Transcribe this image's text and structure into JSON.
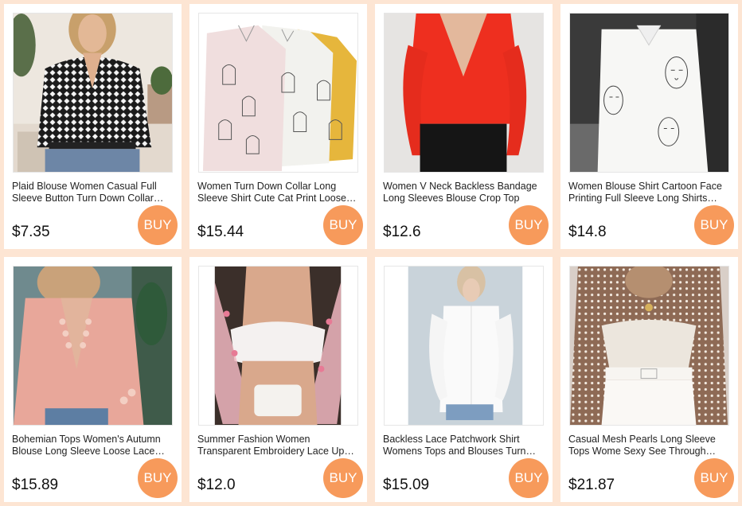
{
  "buy_label": "BUY",
  "accent_color": "#f79a5b",
  "background_color": "#fde5d3",
  "products": [
    {
      "title": "Plaid Blouse Women Casual Full Sleeve Button Turn Down Collar Shirt",
      "price": "$7.35",
      "image": "woman-black-white-plaid-blouse"
    },
    {
      "title": "Women Turn Down Collar Long Sleeve Shirt Cute Cat Print Loose Blouse",
      "price": "$15.44",
      "image": "three-cat-print-shirts-pink-white-yellow"
    },
    {
      "title": "Women V Neck Backless Bandage Long Sleeves Blouse Crop Top",
      "price": "$12.6",
      "image": "woman-red-wrap-crop-blouse"
    },
    {
      "title": "Women Blouse Shirt Cartoon Face Printing Full Sleeve Long Shirts Tops",
      "price": "$14.8",
      "image": "woman-white-face-print-shirt"
    },
    {
      "title": "Bohemian Tops Women's Autumn Blouse Long Sleeve Loose Lace Shirt",
      "price": "$15.89",
      "image": "woman-pink-lace-blouse"
    },
    {
      "title": "Summer Fashion Women Transparent Embroidery Lace Up Crop Top",
      "price": "$12.0",
      "image": "woman-floral-mesh-crop-top"
    },
    {
      "title": "Backless Lace Patchwork Shirt Womens Tops and Blouses Turn Down Collar",
      "price": "$15.09",
      "image": "woman-white-button-shirt"
    },
    {
      "title": "Casual Mesh Pearls Long Sleeve Tops Wome Sexy See Through Blouse",
      "price": "$21.87",
      "image": "woman-pearl-mesh-top-white-corset"
    }
  ]
}
